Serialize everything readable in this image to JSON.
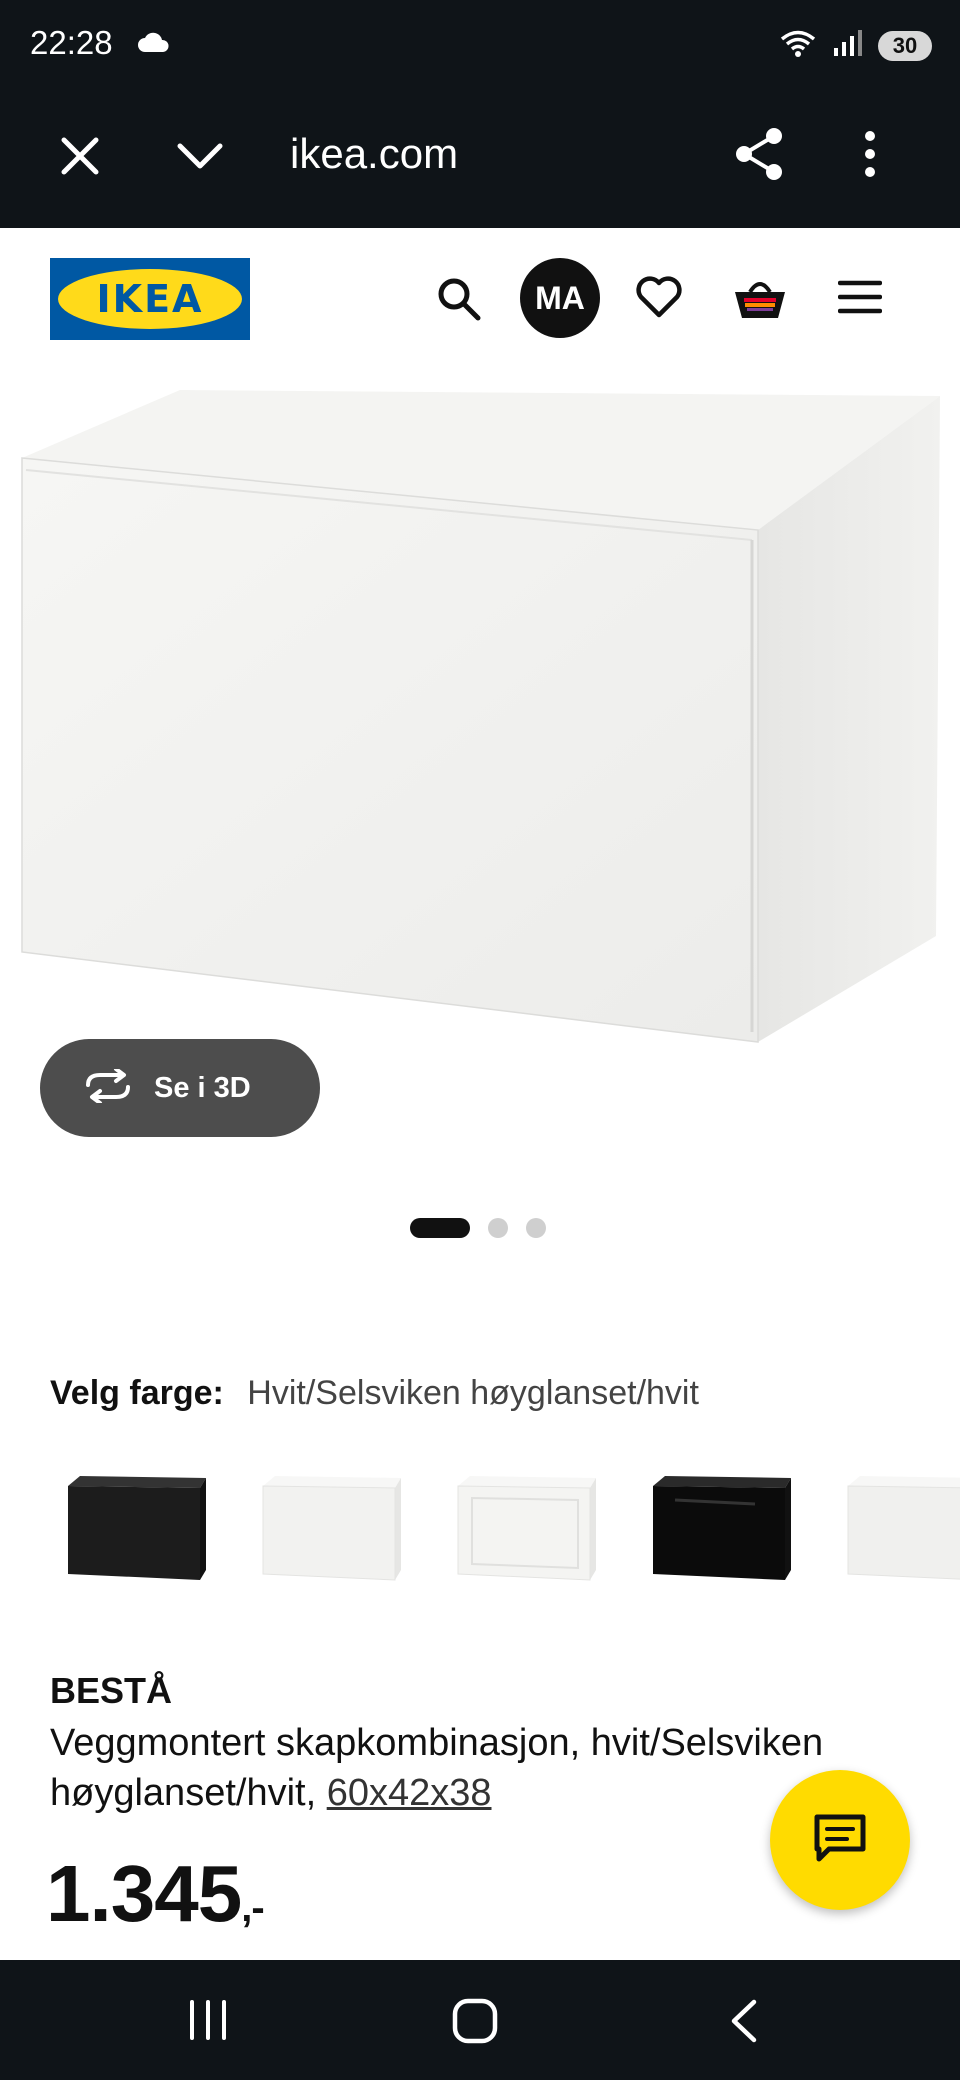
{
  "status_bar": {
    "time": "22:28",
    "battery": "30",
    "icons": [
      "cloud-icon",
      "wifi-icon",
      "signal-icon",
      "battery-icon"
    ]
  },
  "browser": {
    "url": "ikea.com",
    "icons": [
      "close-icon",
      "chevron-down-icon",
      "share-icon",
      "more-vert-icon"
    ]
  },
  "header": {
    "logo_text": "IKEA",
    "avatar_initials": "MA",
    "icons": [
      "search-icon",
      "heart-icon",
      "shopping-bag-icon",
      "hamburger-menu-icon"
    ]
  },
  "gallery": {
    "see_3d_label": "Se i 3D",
    "dots_total": 3,
    "dots_active_index": 0
  },
  "color": {
    "label": "Velg farge:",
    "value": "Hvit/Selsviken høyglanset/hvit",
    "swatches": [
      {
        "name": "black",
        "color": "#1c1c1c"
      },
      {
        "name": "white",
        "color": "#f4f4f2"
      },
      {
        "name": "white-frame",
        "color": "#f7f7f5"
      },
      {
        "name": "black-gloss",
        "color": "#0b0b0b"
      },
      {
        "name": "white-partial",
        "color": "#f2f2f0"
      }
    ]
  },
  "product": {
    "name": "BESTÅ",
    "description": "Veggmontert skapkombinasjon, hvit/Selsviken høyglanset/hvit, ",
    "dimensions": "60x42x38",
    "price": "1.345",
    "price_suffix": ",-"
  },
  "colors": {
    "system_bar": "#0f1418",
    "ikea_blue": "#0058a3",
    "ikea_yellow": "#ffda1a",
    "chat_button": "#ffdb00",
    "see_3d_button": "#4d4d4d"
  }
}
